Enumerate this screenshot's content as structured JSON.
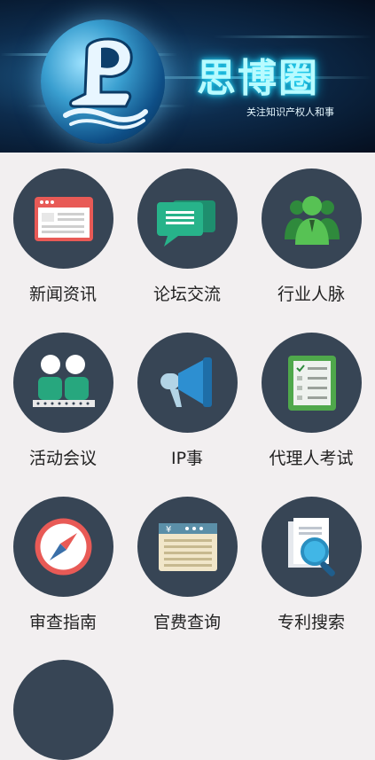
{
  "banner": {
    "title": "思博圈",
    "subtitle": "关注知识产权人和事"
  },
  "menu": [
    {
      "label": "新闻资讯",
      "icon": "news-browser-icon"
    },
    {
      "label": "论坛交流",
      "icon": "chat-bubbles-icon"
    },
    {
      "label": "行业人脉",
      "icon": "people-network-icon"
    },
    {
      "label": "活动会议",
      "icon": "meeting-audience-icon"
    },
    {
      "label": "IP事",
      "icon": "megaphone-icon"
    },
    {
      "label": "代理人考试",
      "icon": "checklist-exam-icon"
    },
    {
      "label": "审查指南",
      "icon": "compass-icon"
    },
    {
      "label": "官费查询",
      "icon": "fee-ledger-icon"
    },
    {
      "label": "专利搜索",
      "icon": "document-search-icon"
    }
  ],
  "colors": {
    "circle_bg": "#374555",
    "page_bg": "#f2eff0",
    "title_glow": "#29e1ff"
  }
}
